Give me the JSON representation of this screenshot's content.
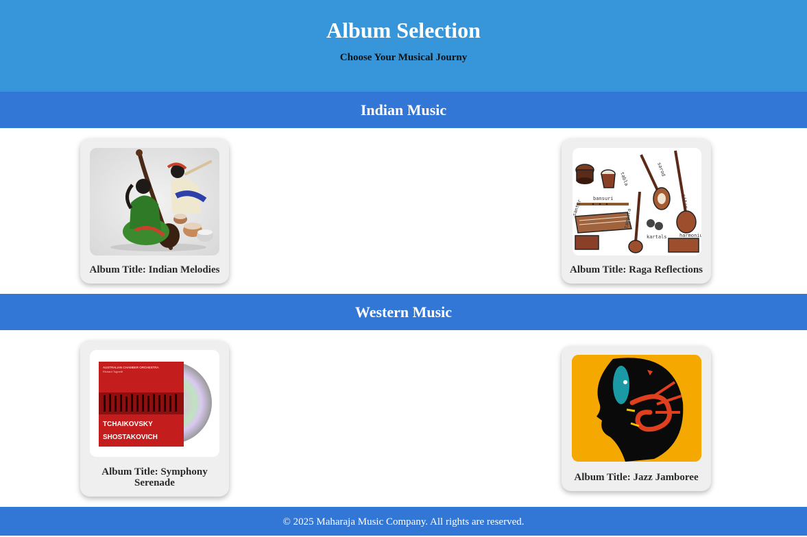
{
  "header": {
    "title": "Album Selection",
    "subtitle": "Choose Your Musical Journy"
  },
  "sections": [
    {
      "heading": "Indian Music",
      "albums": [
        {
          "title": "Album Title: Indian Melodies",
          "art": "indian-musicians-figurine"
        },
        {
          "title": "Album Title: Raga Reflections",
          "art": "indian-instruments-sketch",
          "art_labels": [
            "tabla",
            "sarod",
            "bansuri",
            "santur",
            "sitar",
            "tanpura",
            "kartals",
            "harmonium"
          ]
        }
      ]
    },
    {
      "heading": "Western Music",
      "albums": [
        {
          "title": "Album Title: Symphony Serenade",
          "art": "orchestra-cd-cover",
          "art_text": {
            "line1": "AUSTRALIAN CHAMBER ORCHESTRA",
            "line2": "Richard Tognetti",
            "line3": "TCHAIKOVSKY",
            "line4": "SHOSTAKOVICH"
          }
        },
        {
          "title": "Album Title: Jazz Jamboree",
          "art": "jazz-head-trumpet"
        }
      ]
    }
  ],
  "footer": {
    "text": "© 2025 Maharaja Music Company. All rights are reserved."
  },
  "colors": {
    "header_bg": "#3796d9",
    "section_bg": "#3276d6",
    "card_bg": "#efefef",
    "jazz_bg": "#f5a800"
  }
}
